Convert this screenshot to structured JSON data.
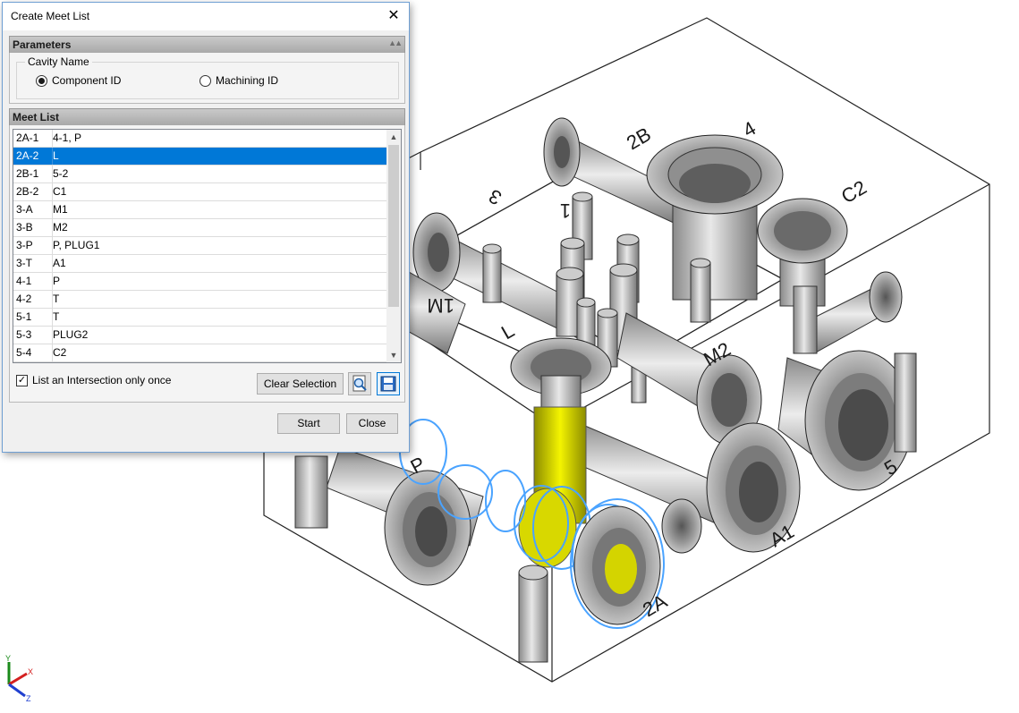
{
  "viewport": {
    "port_labels": [
      "P",
      "2A",
      "A1",
      "5",
      "3",
      "2B",
      "1",
      "C2",
      "1M",
      "M2",
      "L",
      "4"
    ],
    "axis_triad": {
      "x": "X",
      "y": "Y",
      "z": "Z"
    },
    "highlight_color": "#e8e800",
    "selection_outline_color": "#4aa3ff"
  },
  "dialog": {
    "title": "Create Meet List",
    "close_glyph": "✕",
    "parameters": {
      "header": "Parameters",
      "collapse_glyph": "▲▲",
      "cavity_group_label": "Cavity Name",
      "options": [
        {
          "label": "Component ID",
          "selected": true
        },
        {
          "label": "Machining ID",
          "selected": false
        }
      ]
    },
    "meet_list": {
      "header": "Meet List",
      "selected_index": 1,
      "rows": [
        {
          "cavity": "2A-1",
          "meets": "4-1, P"
        },
        {
          "cavity": "2A-2",
          "meets": "L"
        },
        {
          "cavity": "2B-1",
          "meets": "5-2"
        },
        {
          "cavity": "2B-2",
          "meets": "C1"
        },
        {
          "cavity": "3-A",
          "meets": "M1"
        },
        {
          "cavity": "3-B",
          "meets": "M2"
        },
        {
          "cavity": "3-P",
          "meets": "P, PLUG1"
        },
        {
          "cavity": "3-T",
          "meets": "A1"
        },
        {
          "cavity": "4-1",
          "meets": "P"
        },
        {
          "cavity": "4-2",
          "meets": "T"
        },
        {
          "cavity": "5-1",
          "meets": "T"
        },
        {
          "cavity": "5-3",
          "meets": "PLUG2"
        },
        {
          "cavity": "5-4",
          "meets": "C2"
        }
      ],
      "scroll_up_glyph": "▲",
      "scroll_down_glyph": "▼"
    },
    "list_once_label": "List an Intersection only once",
    "list_once_checked": true,
    "check_glyph": "✓",
    "clear_selection_label": "Clear Selection",
    "start_label": "Start",
    "close_label": "Close",
    "accent_color": "#0078d7"
  }
}
